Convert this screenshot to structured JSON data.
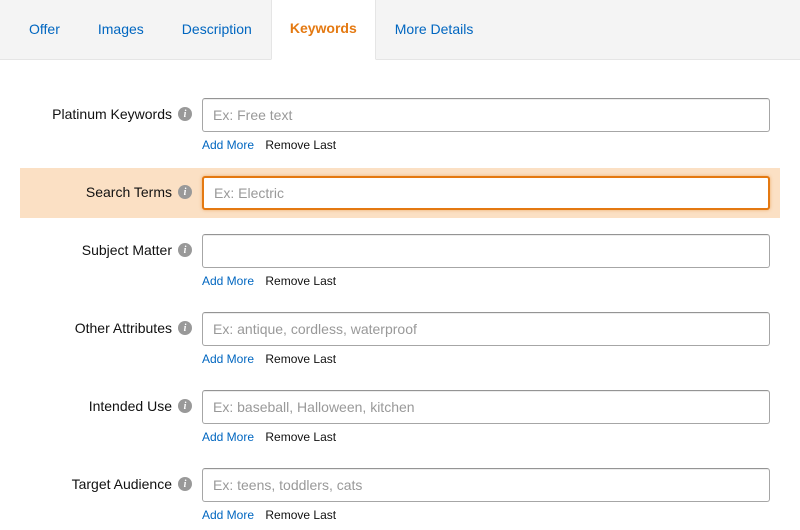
{
  "tabs": {
    "offer": "Offer",
    "images": "Images",
    "description": "Description",
    "keywords": "Keywords",
    "more_details": "More Details"
  },
  "active_tab": "keywords",
  "actions": {
    "add_more": "Add More",
    "remove_last": "Remove Last"
  },
  "fields": {
    "platinum_keywords": {
      "label": "Platinum Keywords",
      "placeholder": "Ex: Free text",
      "value": ""
    },
    "search_terms": {
      "label": "Search Terms",
      "placeholder": "Ex: Electric",
      "value": ""
    },
    "subject_matter": {
      "label": "Subject Matter",
      "placeholder": "",
      "value": ""
    },
    "other_attributes": {
      "label": "Other Attributes",
      "placeholder": "Ex: antique, cordless, waterproof",
      "value": ""
    },
    "intended_use": {
      "label": "Intended Use",
      "placeholder": "Ex: baseball, Halloween, kitchen",
      "value": ""
    },
    "target_audience": {
      "label": "Target Audience",
      "placeholder": "Ex: teens, toddlers, cats",
      "value": ""
    }
  }
}
